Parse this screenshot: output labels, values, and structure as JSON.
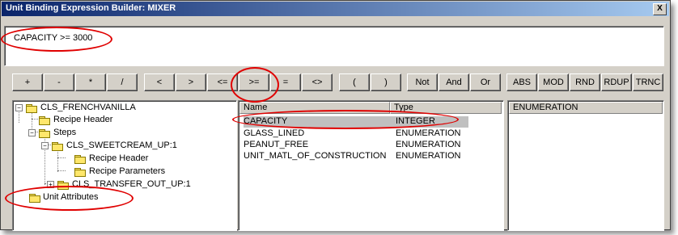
{
  "window": {
    "title": "Unit Binding Expression Builder: MIXER",
    "close_label": "X"
  },
  "expression": {
    "value": "CAPACITY >= 3000"
  },
  "operators": [
    "+",
    "-",
    "*",
    "/",
    "<",
    ">",
    "<=",
    ">=",
    "=",
    "<>",
    "(",
    ")",
    "Not",
    "And",
    "Or",
    "ABS",
    "MOD",
    "RND",
    "RDUP",
    "TRNC"
  ],
  "tree": {
    "items": [
      {
        "label": "CLS_FRENCHVANILLA",
        "expander": "−"
      },
      {
        "label": "Recipe Header"
      },
      {
        "label": "Steps",
        "expander": "−"
      },
      {
        "label": "CLS_SWEETCREAM_UP:1",
        "expander": "−"
      },
      {
        "label": "Recipe Header"
      },
      {
        "label": "Recipe Parameters"
      },
      {
        "label": "CLS_TRANSFER_OUT_UP:1",
        "expander": "+"
      },
      {
        "label": "Unit Attributes"
      }
    ]
  },
  "attributes": {
    "columns": {
      "name": "Name",
      "type": "Type"
    },
    "rows": [
      {
        "name": "CAPACITY",
        "type": "INTEGER",
        "selected": true
      },
      {
        "name": "GLASS_LINED",
        "type": "ENUMERATION"
      },
      {
        "name": "PEANUT_FREE",
        "type": "ENUMERATION"
      },
      {
        "name": "UNIT_MATL_OF_CONSTRUCTION",
        "type": "ENUMERATION"
      }
    ]
  },
  "enumeration": {
    "header": "ENUMERATION"
  },
  "colors": {
    "title_start": "#0a246a",
    "title_end": "#a6caf0",
    "face": "#d4d0c8",
    "highlight_ring": "#e00000",
    "selection": "#c0c0c0"
  }
}
